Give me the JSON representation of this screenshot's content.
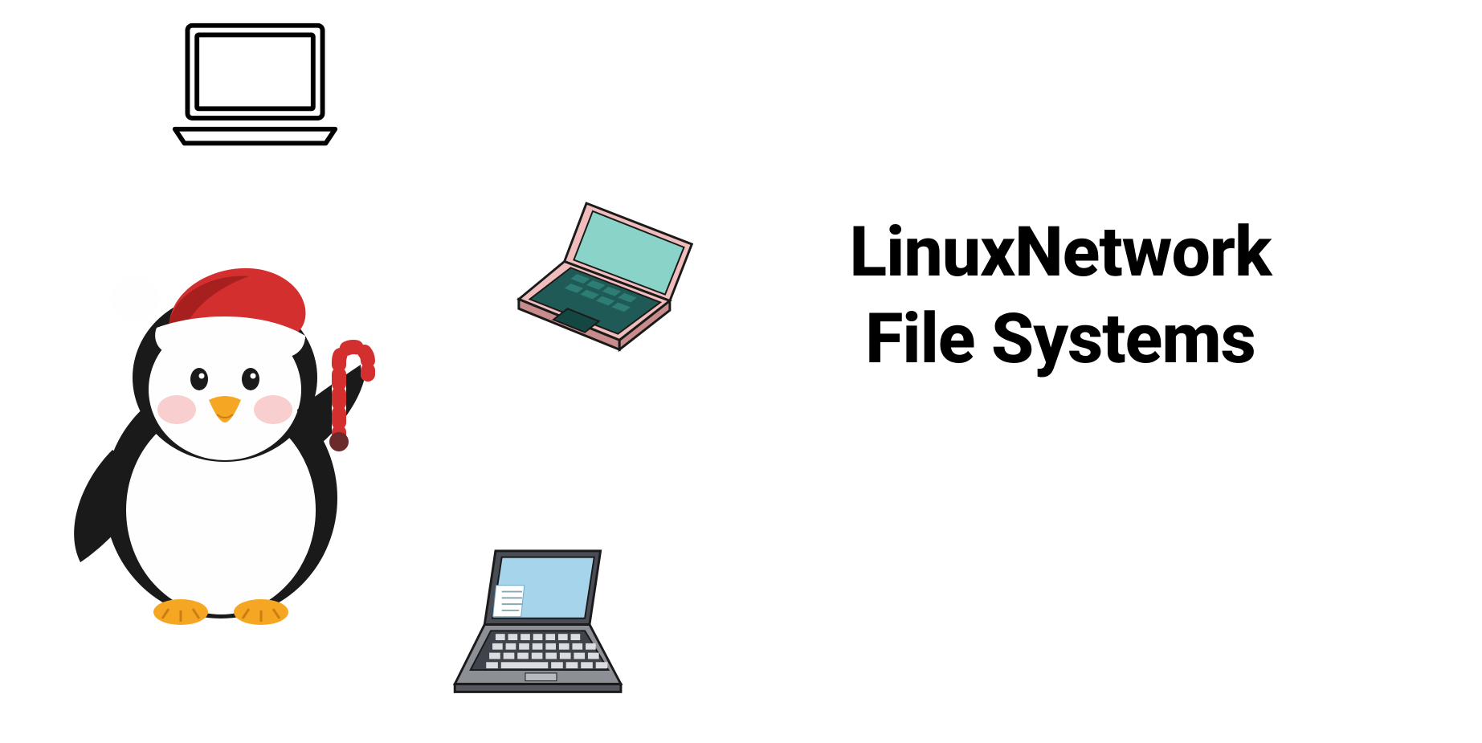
{
  "title_line1": "LinuxNetwork",
  "title_line2": "File Systems",
  "icons": {
    "penguin": "penguin-santa-icon",
    "laptop_outline": "laptop-outline-icon",
    "laptop_iso": "laptop-isometric-pink-icon",
    "laptop_gray": "laptop-gray-icon"
  },
  "colors": {
    "text": "#000000",
    "santa_red": "#d32f2f",
    "santa_red_dark": "#a81f1f",
    "penguin_white": "#fefefe",
    "penguin_black": "#1a1a1a",
    "beak": "#f5a623",
    "blush": "#f7c9c9",
    "iso_screen": "#8ad3c8",
    "iso_body": "#f0bcbc",
    "iso_keyboard": "#1f5a56",
    "gray_screen": "#a6d4ea",
    "gray_body": "#666970",
    "gray_key": "#dcdde1"
  }
}
